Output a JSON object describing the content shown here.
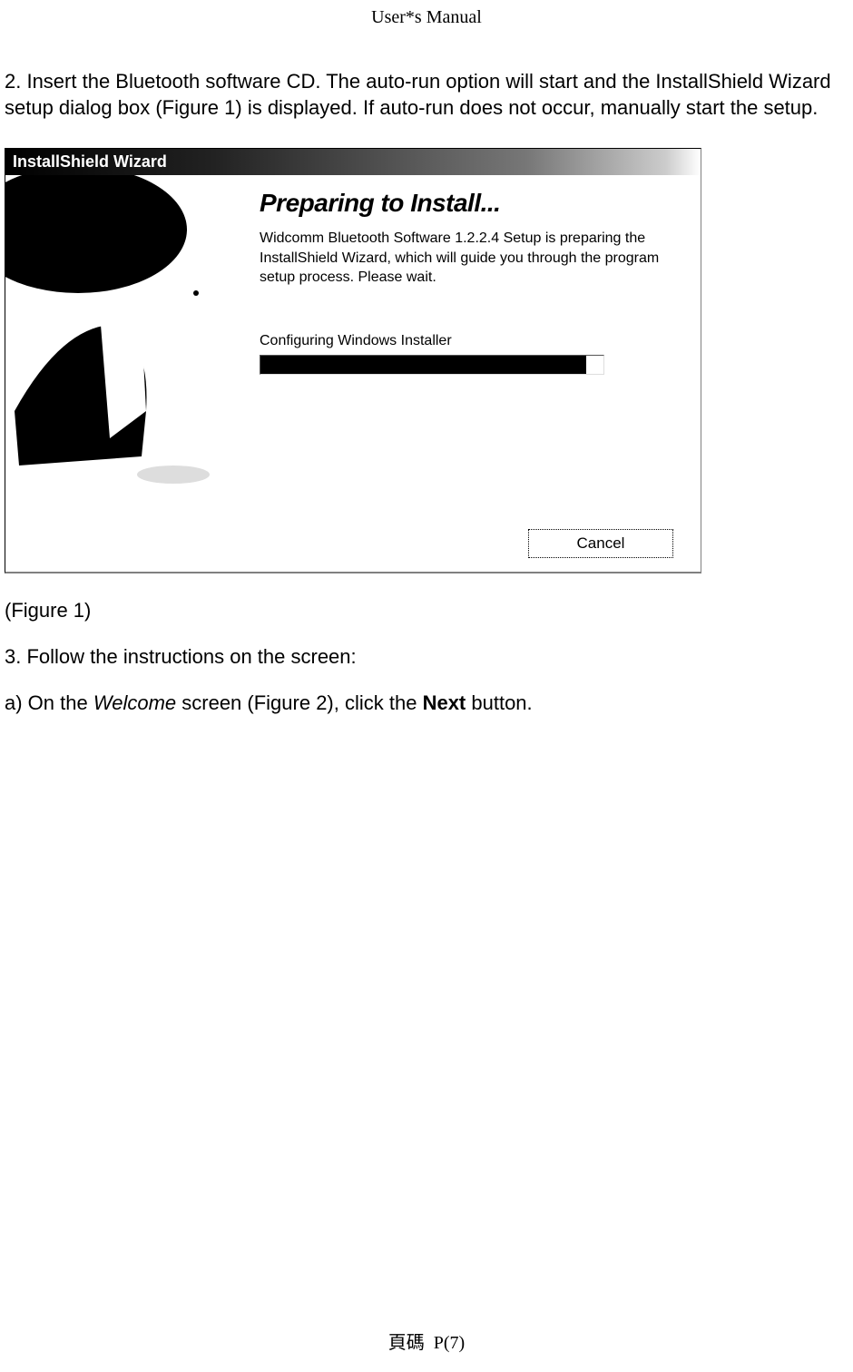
{
  "header": "User*s Manual",
  "instruction": "2. Insert the Bluetooth software CD. The auto-run option will start and the InstallShield Wizard setup dialog box (Figure 1) is displayed. If auto-run does not occur, manually start the setup.",
  "dialog": {
    "title": "InstallShield Wizard",
    "heading": "Preparing to Install...",
    "body": "Widcomm Bluetooth Software 1.2.2.4 Setup is preparing the InstallShield Wizard, which will guide you through the program setup process.  Please wait.",
    "status": "Configuring Windows Installer",
    "progress_percent": 95,
    "cancel_label": "Cancel"
  },
  "figure_caption": "(Figure 1)",
  "step3": "3. Follow the instructions on the screen:",
  "step3a_prefix": "a) On the ",
  "step3a_italic": "Welcome",
  "step3a_mid": " screen (Figure 2), click the ",
  "step3a_bold": "Next",
  "step3a_suffix": " button.",
  "footer_prefix": "頁碼",
  "footer_page": "P(7)"
}
